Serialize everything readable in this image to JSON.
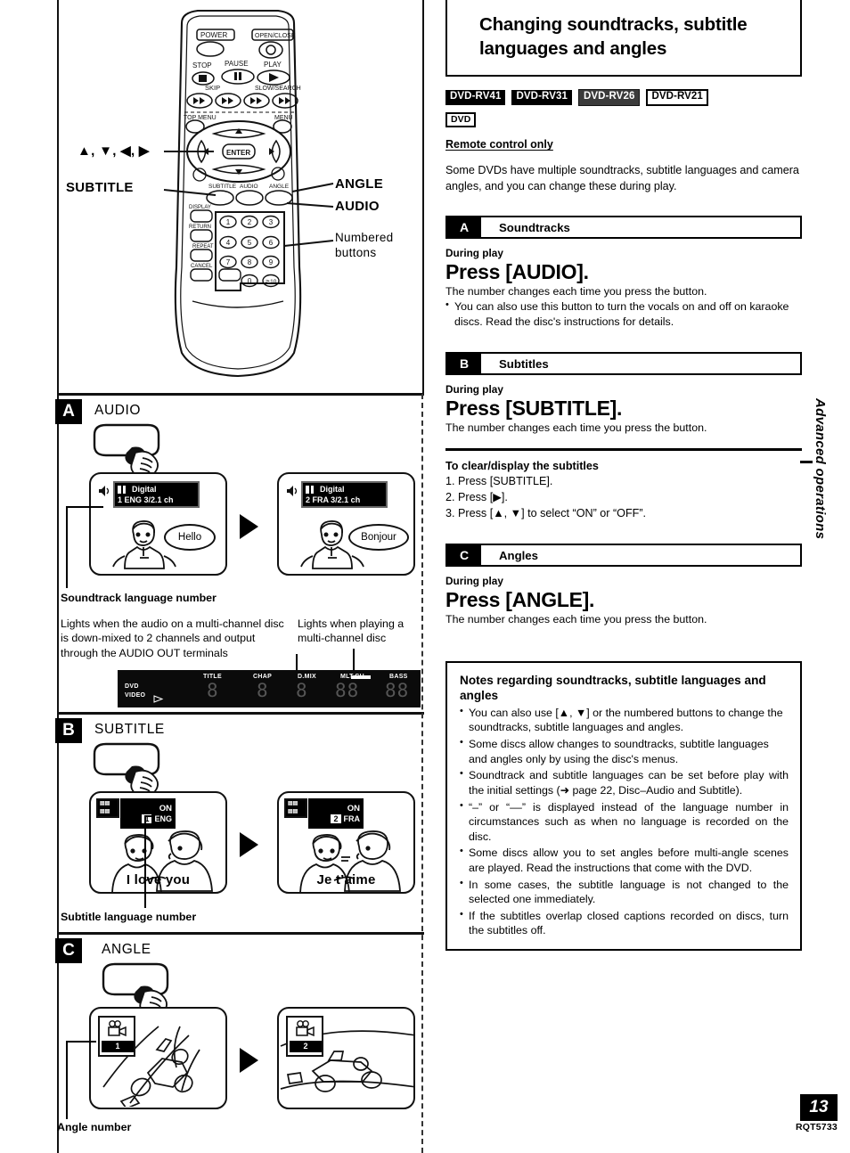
{
  "page": {
    "number": "13",
    "code": "RQT5733",
    "side_tab": "Advanced operations"
  },
  "right": {
    "title": "Changing soundtracks, subtitle languages and angles",
    "model_badges": [
      {
        "label": "DVD-RV41",
        "style": "inverted"
      },
      {
        "label": "DVD-RV31",
        "style": "inverted"
      },
      {
        "label": "DVD-RV26",
        "style": "inverted-light"
      },
      {
        "label": "DVD-RV21",
        "style": "outlined"
      }
    ],
    "media_badge": "DVD",
    "remote_only": "Remote control only",
    "intro": "Some DVDs have multiple soundtracks, subtitle languages and camera angles, and you can change these during play.",
    "sections": [
      {
        "letter": "A",
        "name": "Soundtracks",
        "during": "During play",
        "press": "Press [AUDIO].",
        "subline": "The number changes each time you press the button.",
        "bullets": [
          "You can also use this button to turn the vocals on and off on karaoke discs. Read the disc's instructions for details."
        ]
      },
      {
        "letter": "B",
        "name": "Subtitles",
        "during": "During play",
        "press": "Press [SUBTITLE].",
        "subline": "The number changes each time you press the button.",
        "steps_title": "To clear/display the subtitles",
        "steps": [
          "1. Press [SUBTITLE].",
          "2. Press [▶].",
          "3. Press [▲, ▼] to select “ON” or “OFF”."
        ]
      },
      {
        "letter": "C",
        "name": "Angles",
        "during": "During play",
        "press": "Press [ANGLE].",
        "subline": "The number changes each time you press the button."
      }
    ],
    "notes": {
      "heading": "Notes regarding soundtracks, subtitle languages and angles",
      "items": [
        "You can also use [▲, ▼] or the numbered buttons to change the soundtracks, subtitle languages and angles.",
        "Some discs allow changes to soundtracks, subtitle languages and angles only by using the disc's menus.",
        "Soundtrack and subtitle languages can be set before play with the initial settings (➜ page 22, Disc–Audio and Subtitle).",
        "“–” or “––” is displayed instead of the language number in circumstances such as when no language is recorded on the disc.",
        "Some discs allow you to set angles before multi-angle scenes are played. Read the instructions that come with the DVD.",
        "In some cases, the subtitle language is not changed to the selected one immediately.",
        "If the subtitles overlap closed captions recorded on discs, turn the subtitles off."
      ]
    }
  },
  "left": {
    "remote": {
      "callouts": [
        {
          "key": "cursor",
          "label": "▲, ▼, ◀, ▶"
        },
        {
          "key": "subtitle",
          "label": "SUBTITLE"
        },
        {
          "key": "angle",
          "label": "ANGLE"
        },
        {
          "key": "audio",
          "label": "AUDIO"
        },
        {
          "key": "numbered",
          "label": "Numbered buttons"
        }
      ],
      "buttons": {
        "power": "POWER",
        "open_close": "OPEN/CLOSE",
        "stop": "STOP",
        "pause": "PAUSE",
        "play": "PLAY",
        "skip": "SKIP",
        "slow_search": "SLOW/SEARCH",
        "top_menu": "TOP MENU",
        "menu": "MENU",
        "enter": "ENTER",
        "subtitle": "SUBTITLE",
        "audio": "AUDIO",
        "angle": "ANGLE",
        "display": "DISPLAY",
        "return": "RETURN",
        "repeat": "REPEAT",
        "cancel": "CANCEL",
        "numbers": [
          "1",
          "2",
          "3",
          "4",
          "5",
          "6",
          "7",
          "8",
          "9",
          "0",
          "≧10"
        ]
      }
    },
    "panels": [
      {
        "letter": "A",
        "button_label": "AUDIO",
        "caption": "Soundtrack language number",
        "screens": [
          {
            "osd_top": "Digital",
            "osd_bottom": "1 ENG  3/2.1 ch",
            "speech": "Hello",
            "logo": "dolby-digital"
          },
          {
            "osd_top": "Digital",
            "osd_bottom": "2 FRA  3/2.1 ch",
            "speech": "Bonjour",
            "logo": "dolby-digital"
          }
        ],
        "notes": [
          "Lights when the audio on a multi-channel disc is down-mixed to 2 channels and output through the AUDIO OUT terminals",
          "Lights when playing a multi-channel disc"
        ],
        "display_panel": {
          "left_labels": [
            "DVD",
            "VIDEO"
          ],
          "indicators": [
            "TITLE",
            "CHAP",
            "D.MIX",
            "MLT.CH",
            "BASS"
          ]
        }
      },
      {
        "letter": "B",
        "button_label": "SUBTITLE",
        "caption": "Subtitle language number",
        "screens": [
          {
            "osd_top": "ON",
            "osd_bottom_num": "1",
            "osd_bottom_lang": "ENG",
            "subtitle": "I love you"
          },
          {
            "osd_top": "ON",
            "osd_bottom_num": "2",
            "osd_bottom_lang": "FRA",
            "subtitle": "Je t’aime"
          }
        ]
      },
      {
        "letter": "C",
        "button_label": "ANGLE",
        "caption": "Angle number",
        "screens": [
          {
            "angle_num": "1"
          },
          {
            "angle_num": "2"
          }
        ]
      }
    ]
  }
}
